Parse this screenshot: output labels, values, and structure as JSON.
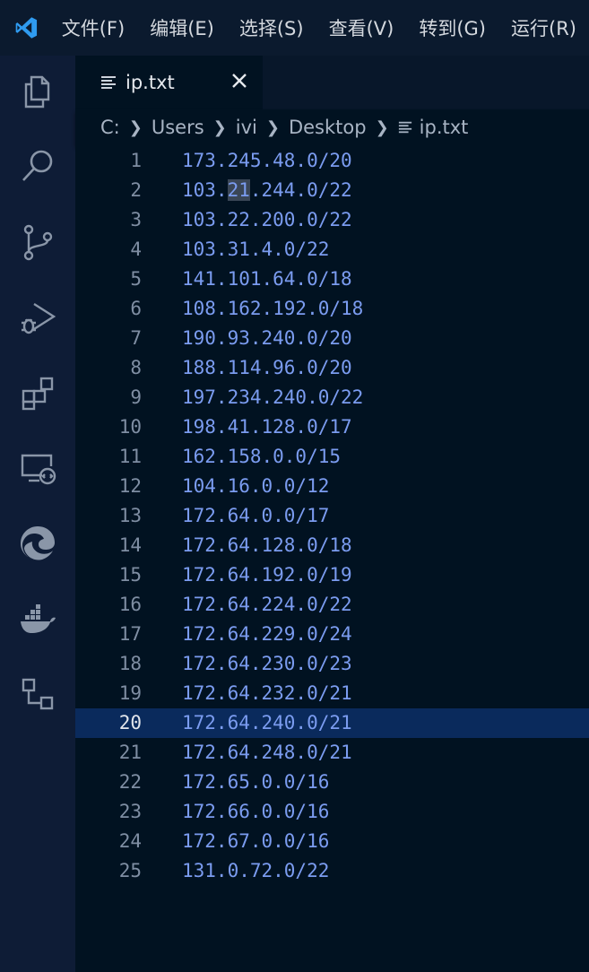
{
  "menu": [
    "文件(F)",
    "编辑(E)",
    "选择(S)",
    "查看(V)",
    "转到(G)",
    "运行(R)"
  ],
  "activity_icons": [
    "explorer-icon",
    "search-icon",
    "source-control-icon",
    "run-debug-icon",
    "extensions-icon",
    "remote-explorer-icon",
    "edge-icon",
    "docker-icon",
    "scm-graph-icon"
  ],
  "tab": {
    "label": "ip.txt"
  },
  "breadcrumb": [
    "C:",
    "Users",
    "ivi",
    "Desktop",
    "ip.txt"
  ],
  "editor": {
    "active_line": 20,
    "lines": [
      "173.245.48.0/20",
      "103.21.244.0/22",
      "103.22.200.0/22",
      "103.31.4.0/22",
      "141.101.64.0/18",
      "108.162.192.0/18",
      "190.93.240.0/20",
      "188.114.96.0/20",
      "197.234.240.0/22",
      "198.41.128.0/17",
      "162.158.0.0/15",
      "104.16.0.0/12",
      "172.64.0.0/17",
      "172.64.128.0/18",
      "172.64.192.0/19",
      "172.64.224.0/22",
      "172.64.229.0/24",
      "172.64.230.0/23",
      "172.64.232.0/21",
      "172.64.240.0/21",
      "172.64.248.0/21",
      "172.65.0.0/16",
      "172.66.0.0/16",
      "172.67.0.0/16",
      "131.0.72.0/22"
    ]
  },
  "colors": {
    "accent": "#2f9bf0",
    "code_text": "#7b9cf0",
    "active_line": "#0a2a5c",
    "match_highlight": "#3a4656"
  }
}
